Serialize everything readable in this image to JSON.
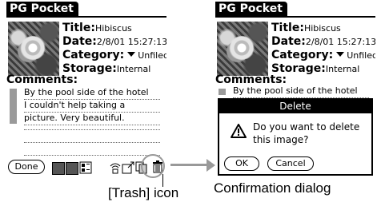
{
  "app": {
    "title": "PG Pocket"
  },
  "details": {
    "title_label": "Title:",
    "title_value": "Hibiscus",
    "date_label": "Date:",
    "date_value": "2/8/01 15:27:13",
    "category_label": "Category:",
    "category_value": "Unfiled",
    "storage_label": "Storage:",
    "storage_value": "Internal"
  },
  "comments": {
    "label": "Comments:",
    "lines": [
      "By the pool side of the hotel",
      "I couldn't help taking a",
      "picture. Very beautiful."
    ]
  },
  "toolbar": {
    "done_label": "Done"
  },
  "dialog": {
    "title": "Delete",
    "message_line1": "Do you want to delete",
    "message_line2": "this image?",
    "ok_label": "OK",
    "cancel_label": "Cancel"
  },
  "captions": {
    "trash_icon": "[Trash] icon",
    "confirmation": "Confirmation dialog"
  },
  "icons": [
    "triangle-down-icon",
    "list-view-icon",
    "thumbnail-view-icon",
    "beam-icon",
    "send-icon",
    "copy-icon",
    "trash-icon",
    "warning-icon"
  ],
  "colors": {
    "titlebar": "#000000",
    "note_bar": "#9a9a9a",
    "arrow": "#999999"
  }
}
